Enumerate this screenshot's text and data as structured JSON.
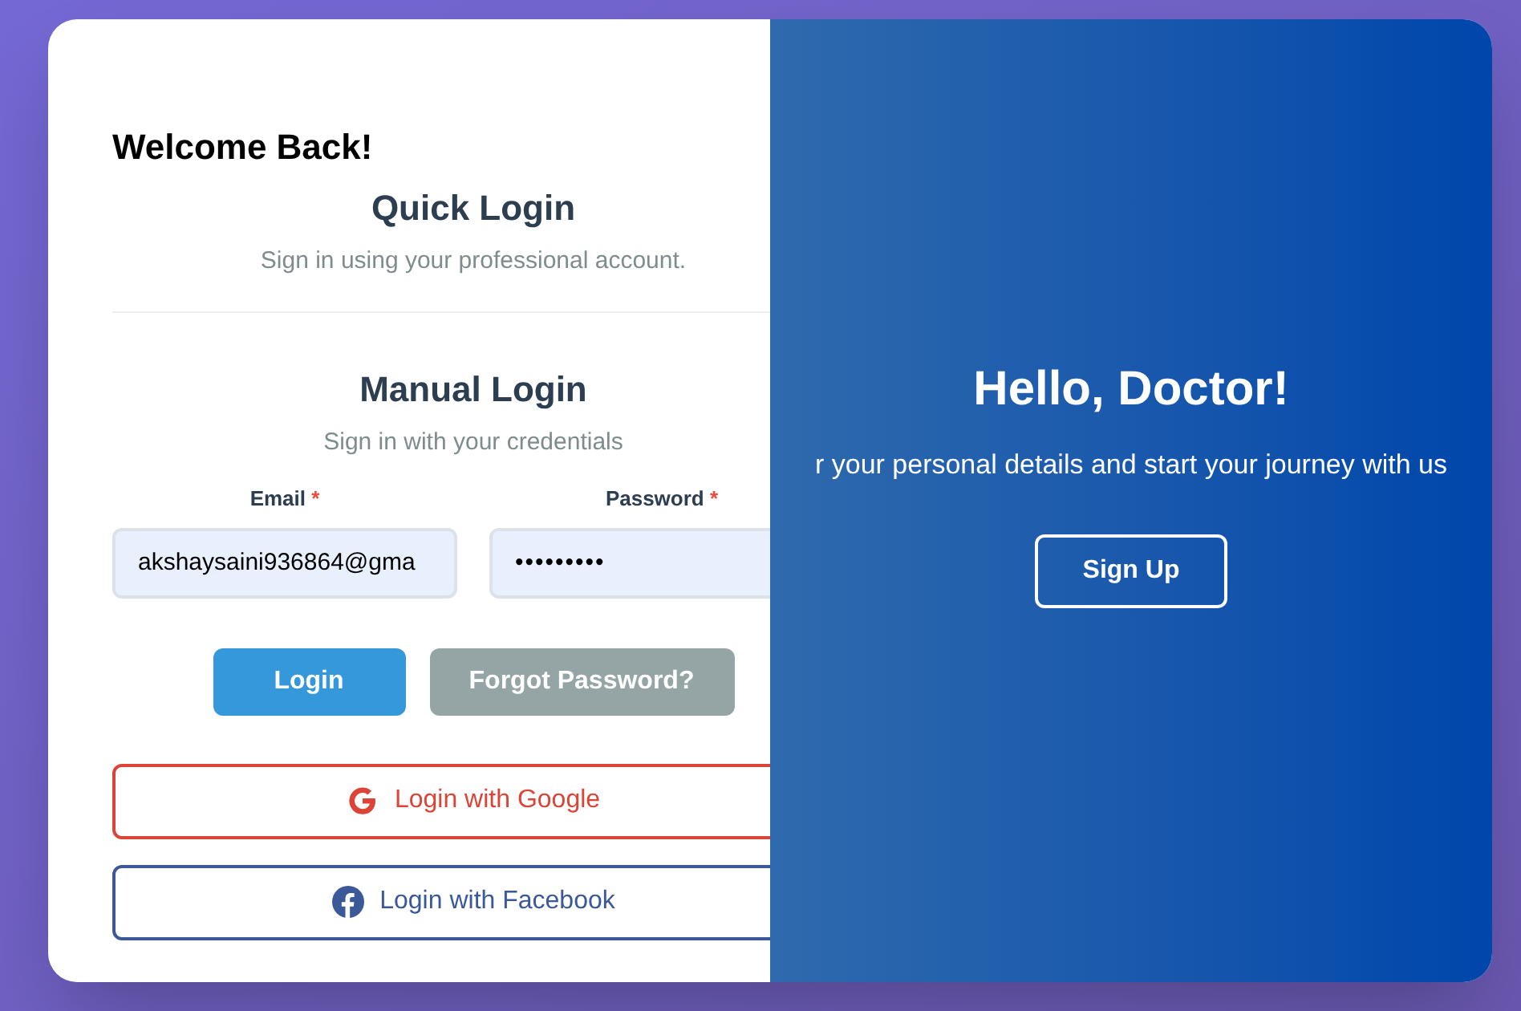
{
  "welcome": "Welcome Back!",
  "quick_login": {
    "title": "Quick Login",
    "subtitle": "Sign in using your professional account."
  },
  "manual_login": {
    "title": "Manual Login",
    "subtitle": "Sign in with your credentials"
  },
  "fields": [
    {
      "label": "Email",
      "required_mark": "*",
      "value": "akshaysaini936864@gma",
      "kind": "text"
    },
    {
      "label": "Password",
      "required_mark": "*",
      "value": "•••••••••",
      "kind": "password"
    }
  ],
  "buttons": [
    {
      "label": "Login",
      "kind": "primary"
    },
    {
      "label": "Forgot Password?",
      "kind": "secondary"
    }
  ],
  "social": [
    {
      "label": "Login with Google",
      "kind": "google"
    },
    {
      "label": "Login with Facebook",
      "kind": "facebook"
    }
  ],
  "overlay": {
    "title": "Hello, Doctor!",
    "text": "r your personal details and start your journey with us",
    "button": "Sign Up"
  }
}
